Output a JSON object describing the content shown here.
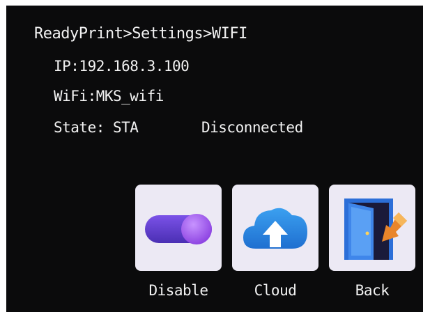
{
  "header": {
    "breadcrumb": "ReadyPrint>Settings>WIFI"
  },
  "status": {
    "ip": "IP:192.168.3.100",
    "wifi": "WiFi:MKS_wifi",
    "state_label": "State: STA",
    "state_value": "Disconnected"
  },
  "buttons": {
    "disable": {
      "label": "Disable",
      "icon": "toggle-switch-icon"
    },
    "cloud": {
      "label": "Cloud",
      "icon": "cloud-upload-icon"
    },
    "back": {
      "label": "Back",
      "icon": "exit-door-icon"
    }
  },
  "colors": {
    "screen_background": "#0b0b0c",
    "text": "#f2f2f2",
    "tile_background": "#ece9f4",
    "toggle_purple": "#6a3fd6",
    "cloud_blue": "#2a86e0",
    "door_blue": "#2c6fd8",
    "arrow_orange": "#e9852a"
  }
}
